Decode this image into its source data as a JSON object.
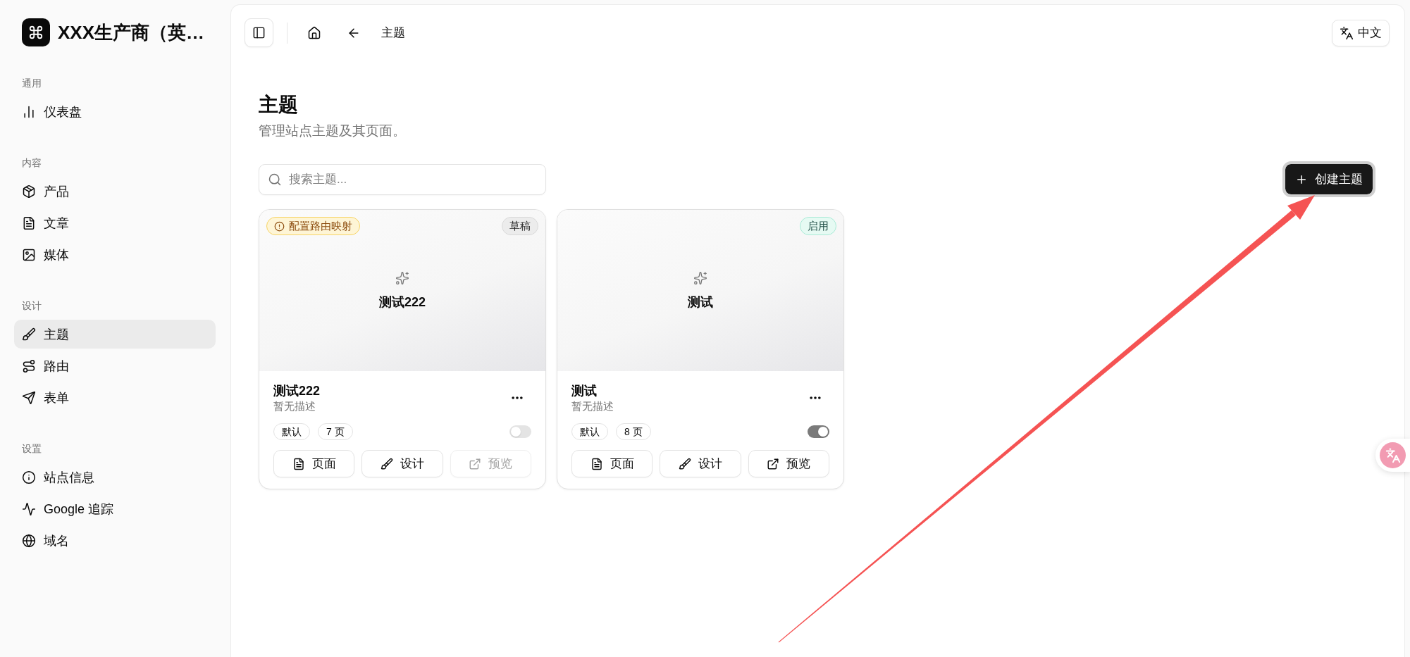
{
  "sidebar": {
    "brand": "XXX生产商（英…",
    "groups": [
      {
        "label": "通用",
        "items": [
          {
            "label": "仪表盘",
            "selected": false
          }
        ]
      },
      {
        "label": "内容",
        "items": [
          {
            "label": "产品",
            "selected": false
          },
          {
            "label": "文章",
            "selected": false
          },
          {
            "label": "媒体",
            "selected": false
          }
        ]
      },
      {
        "label": "设计",
        "items": [
          {
            "label": "主题",
            "selected": true
          },
          {
            "label": "路由",
            "selected": false
          },
          {
            "label": "表单",
            "selected": false
          }
        ]
      },
      {
        "label": "设置",
        "items": [
          {
            "label": "站点信息",
            "selected": false
          },
          {
            "label": "Google 追踪",
            "selected": false
          },
          {
            "label": "域名",
            "selected": false
          }
        ]
      }
    ]
  },
  "topbar": {
    "breadcrumb": "主题",
    "language": "中文"
  },
  "header": {
    "title": "主题",
    "subtitle": "管理站点主题及其页面。"
  },
  "toolbar": {
    "search": {
      "placeholder": "搜索主题..."
    },
    "create_button": "创建主题"
  },
  "themes": [
    {
      "preview_title": "测试222",
      "warning": "配置路由映射",
      "status": {
        "label": "草稿",
        "kind": "draft"
      },
      "name": "测试222",
      "description": "暂无描述",
      "tags": [
        "默认",
        "7 页"
      ],
      "on": false,
      "actions": [
        {
          "label": "页面",
          "disabled": false
        },
        {
          "label": "设计",
          "disabled": false
        },
        {
          "label": "预览",
          "disabled": true
        }
      ]
    },
    {
      "preview_title": "测试",
      "status": {
        "label": "启用",
        "kind": "active"
      },
      "name": "测试",
      "description": "暂无描述",
      "tags": [
        "默认",
        "8 页"
      ],
      "on": true,
      "actions": [
        {
          "label": "页面",
          "disabled": false
        },
        {
          "label": "设计",
          "disabled": false
        },
        {
          "label": "预览",
          "disabled": false
        }
      ]
    }
  ]
}
